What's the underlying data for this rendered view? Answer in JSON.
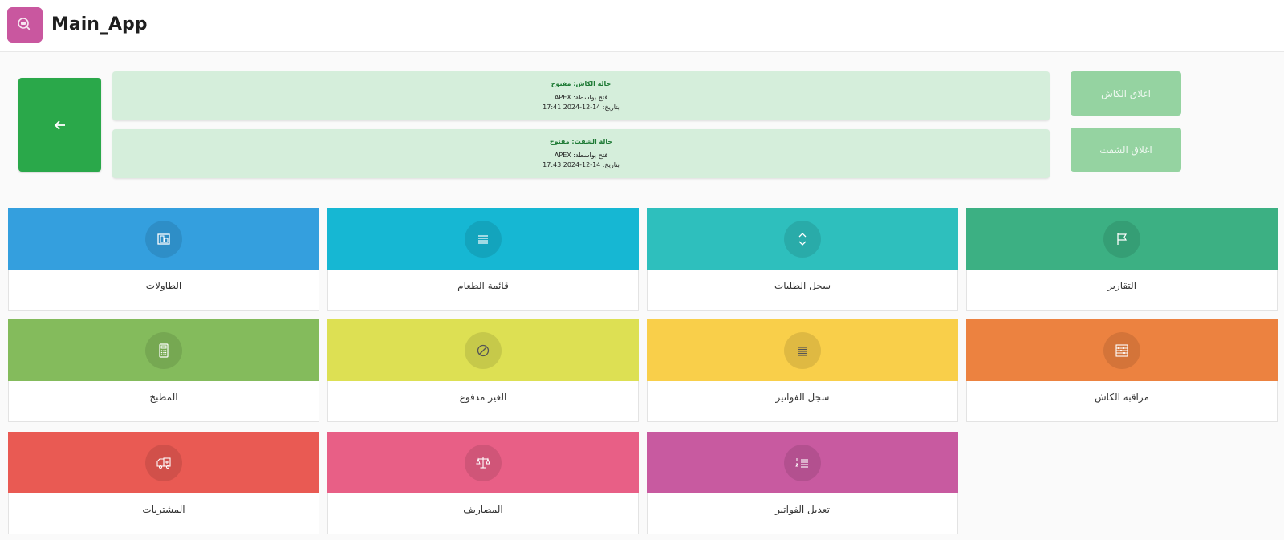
{
  "header": {
    "title": "Main_App",
    "logo_icon": "search-icon",
    "logo_color": "#c9579f"
  },
  "back_button": {
    "icon": "arrow-left-icon",
    "color": "#2aa84a"
  },
  "status_cards": [
    {
      "status": "حالة الكاش: مفتوح",
      "opened_by": "فتح بواسطة: APEX",
      "date": "بتاريخ: 14-12-2024 17:41"
    },
    {
      "status": "حالة الشفت: مفتوح",
      "opened_by": "فتح بواسطة: APEX",
      "date": "بتاريخ: 14-12-2024 17:43"
    }
  ],
  "actions": {
    "close_cash": "اغلاق الكاش",
    "close_shift": "اغلاق الشفت"
  },
  "tiles": [
    {
      "label": "الطاولات",
      "icon": "floor-plan-icon",
      "color": "#349fde"
    },
    {
      "label": "قائمة الطعام",
      "icon": "list-icon",
      "color": "#16b7d3"
    },
    {
      "label": "سجل الطلبات",
      "icon": "sort-icon",
      "color": "#2ebfbd"
    },
    {
      "label": "التقارير",
      "icon": "flag-icon",
      "color": "#3cb083"
    },
    {
      "label": "المطبخ",
      "icon": "calculator-icon",
      "color": "#84bb5c"
    },
    {
      "label": "الغير مدفوع",
      "icon": "ban-icon",
      "color": "#dde053"
    },
    {
      "label": "سجل الفواتير",
      "icon": "align-justify-icon",
      "color": "#f9cf4a"
    },
    {
      "label": "مراقبة الكاش",
      "icon": "abacus-icon",
      "color": "#ec8240"
    },
    {
      "label": "المشتريات",
      "icon": "ambulance-icon",
      "color": "#e95a53"
    },
    {
      "label": "المصاريف",
      "icon": "balance-scale-icon",
      "color": "#e85f86"
    },
    {
      "label": "تعديل الفواتير",
      "icon": "list-ordered-icon",
      "color": "#c85aa0"
    }
  ]
}
